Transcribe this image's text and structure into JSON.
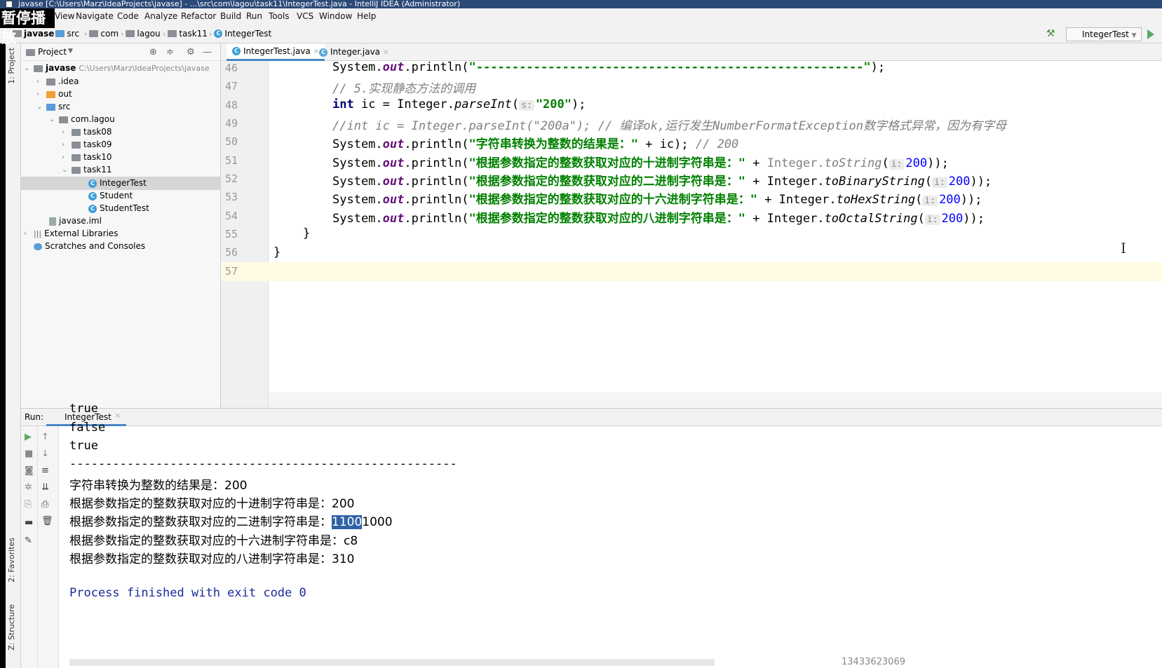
{
  "titlebar": {
    "title": "javase [C:\\Users\\Marz\\IdeaProjects\\javase] - ...\\src\\com\\lagou\\task11\\IntegerTest.java - IntelliJ IDEA (Administrator)"
  },
  "overlay": {
    "text": "暂停播放"
  },
  "menu": [
    "View",
    "Navigate",
    "Code",
    "Analyze",
    "Refactor",
    "Build",
    "Run",
    "Tools",
    "VCS",
    "Window",
    "Help"
  ],
  "breadcrumb": [
    "javase",
    "src",
    "com",
    "lagou",
    "task11",
    "IntegerTest"
  ],
  "run_config": "IntegerTest",
  "side_tabs": {
    "project": "1: Project",
    "favorites": "2: Favorites",
    "structure": "Z: Structure"
  },
  "project": {
    "header": "Project",
    "root": "javase",
    "root_path": "C:\\Users\\Marz\\IdeaProjects\\javase",
    "items": [
      ".idea",
      "out",
      "src",
      "com.lagou",
      "task08",
      "task09",
      "task10",
      "task11",
      "IntegerTest",
      "Student",
      "StudentTest",
      "javase.iml",
      "External Libraries",
      "Scratches and Consoles"
    ]
  },
  "editor": {
    "tabs": [
      "IntegerTest.java",
      "Integer.java"
    ],
    "line_numbers": [
      "46",
      "47",
      "48",
      "49",
      "50",
      "51",
      "52",
      "53",
      "54",
      "55",
      "56",
      "57"
    ],
    "line46": {
      "a": "System.",
      "b": "out",
      "c": ".println(",
      "d": "\"------------------------------------------------------\"",
      "e": ");"
    },
    "line47": "// 5.实现静态方法的调用",
    "line48": {
      "kw": "int",
      "a": " ic = Integer.",
      "m": "parseInt",
      "p": "(",
      "hint": "s:",
      "str": "\"200\"",
      "e": ");"
    },
    "line49": "//int ic = Integer.parseInt(\"200a\"); // 编译ok,运行发生NumberFormatException数字格式异常，因为有字母",
    "line50": {
      "a": "System.",
      "b": "out",
      "c": ".println(",
      "str": "\"字符串转换为整数的结果是：\"",
      "d": " + ic); ",
      "cm": "// 200"
    },
    "line51": {
      "str": "\"根据参数指定的整数获取对应的十进制字符串是：\"",
      "d": " + ",
      "cls": "Integer.",
      "m": "toString",
      "hint": "i:",
      "num": "200",
      "e": "));"
    },
    "line52": {
      "str": "\"根据参数指定的整数获取对应的二进制字符串是：\"",
      "d": " + Integer.",
      "m": "toBinaryString",
      "hint": "i:",
      "num": "200",
      "e": "));"
    },
    "line53": {
      "str": "\"根据参数指定的整数获取对应的十六进制字符串是：\"",
      "d": " + Integer.",
      "m": "toHexString",
      "hint": "i:",
      "num": "200",
      "e": "));"
    },
    "line54": {
      "str": "\"根据参数指定的整数获取对应的八进制字符串是：\"",
      "d": " + Integer.",
      "m": "toOctalString",
      "hint": "i:",
      "num": "200",
      "e": "));"
    },
    "brace55": "}",
    "brace56": "}"
  },
  "run": {
    "label": "Run:",
    "tab": "IntegerTest",
    "output": [
      "true",
      "false",
      "true",
      "------------------------------------------------------",
      "字符串转换为整数的结果是：200",
      "根据参数指定的整数获取对应的十进制字符串是：200"
    ],
    "binary_prefix": "根据参数指定的整数获取对应的二进制字符串是：",
    "binary_selected": "1100",
    "binary_rest": "1000",
    "output2": [
      "根据参数指定的整数获取对应的十六进制字符串是：c8",
      "根据参数指定的整数获取对应的八进制字符串是：310"
    ],
    "exit": "Process finished with exit code 0"
  },
  "watermark": "13433623069"
}
